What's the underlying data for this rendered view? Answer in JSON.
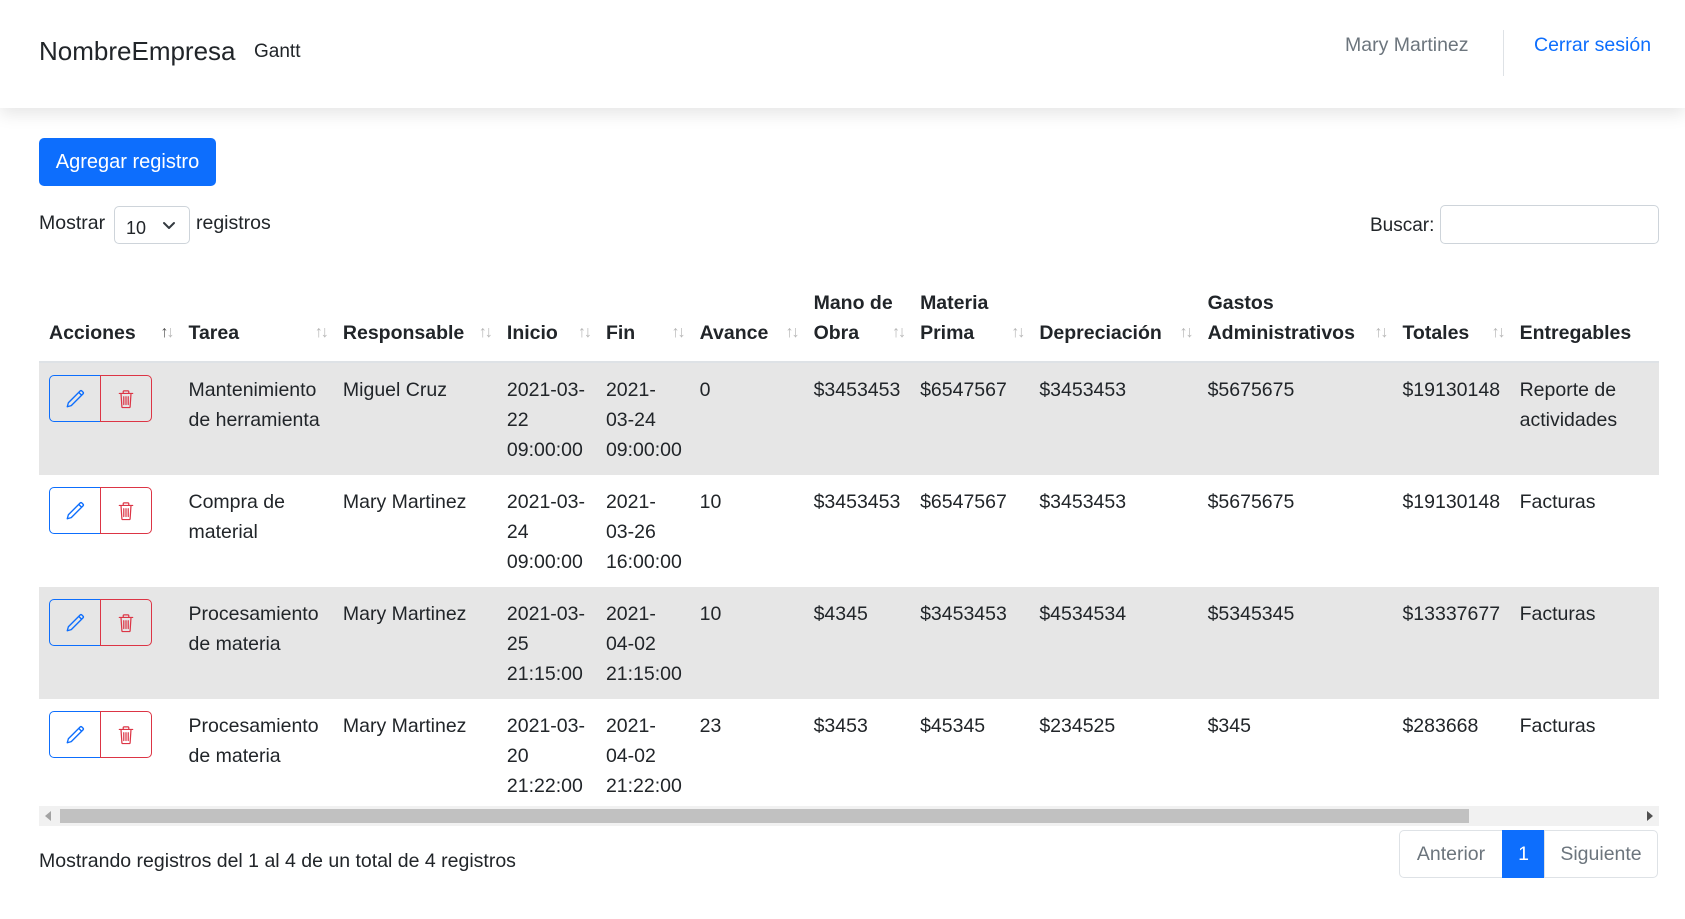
{
  "navbar": {
    "brand": "NombreEmpresa",
    "link": "Gantt",
    "user": "Mary Martinez",
    "logout": "Cerrar sesión"
  },
  "toolbar": {
    "add_label": "Agregar registro",
    "length_prefix": "Mostrar",
    "length_value": "10",
    "length_suffix": "registros",
    "search_label": "Buscar:",
    "search_value": ""
  },
  "table": {
    "headers": [
      {
        "label": "Acciones"
      },
      {
        "label": "Tarea"
      },
      {
        "label": "Responsable"
      },
      {
        "label": "Inicio"
      },
      {
        "label": "Fin"
      },
      {
        "label": "Avance"
      },
      {
        "label": "Mano de Obra"
      },
      {
        "label": "Materia Prima"
      },
      {
        "label": "Depreciación"
      },
      {
        "label": "Gastos Administrativos"
      },
      {
        "label": "Totales"
      },
      {
        "label": "Entregables"
      }
    ],
    "rows": [
      {
        "tarea": "Mantenimiento de herramienta",
        "responsable": "Miguel Cruz",
        "inicio": "2021-03-22 09:00:00",
        "fin": "2021-03-24 09:00:00",
        "avance": "0",
        "mano_obra": "$3453453",
        "materia_prima": "$6547567",
        "depreciacion": "$3453453",
        "gastos": "$5675675",
        "totales": "$19130148",
        "entregables": "Reporte de actividades"
      },
      {
        "tarea": "Compra de material",
        "responsable": "Mary Martinez",
        "inicio": "2021-03-24 09:00:00",
        "fin": "2021-03-26 16:00:00",
        "avance": "10",
        "mano_obra": "$3453453",
        "materia_prima": "$6547567",
        "depreciacion": "$3453453",
        "gastos": "$5675675",
        "totales": "$19130148",
        "entregables": "Facturas"
      },
      {
        "tarea": "Procesamiento de materia",
        "responsable": "Mary Martinez",
        "inicio": "2021-03-25 21:15:00",
        "fin": "2021-04-02 21:15:00",
        "avance": "10",
        "mano_obra": "$4345",
        "materia_prima": "$3453453",
        "depreciacion": "$4534534",
        "gastos": "$5345345",
        "totales": "$13337677",
        "entregables": "Facturas"
      },
      {
        "tarea": "Procesamiento de materia",
        "responsable": "Mary Martinez",
        "inicio": "2021-03-20 21:22:00",
        "fin": "2021-04-02 21:22:00",
        "avance": "23",
        "mano_obra": "$3453",
        "materia_prima": "$45345",
        "depreciacion": "$234525",
        "gastos": "$345",
        "totales": "$283668",
        "entregables": "Facturas"
      }
    ]
  },
  "footer": {
    "info": "Mostrando registros del 1 al 4 de un total de 4 registros",
    "prev": "Anterior",
    "current_page": "1",
    "next": "Siguiente"
  },
  "colors": {
    "primary": "#0d6efd",
    "danger": "#dc3545",
    "row_stripe": "#e6e6e6"
  },
  "icons": {
    "edit": "pencil-icon",
    "delete": "trash-icon",
    "sort": "sort-icon",
    "select": "chevron-down-icon"
  }
}
